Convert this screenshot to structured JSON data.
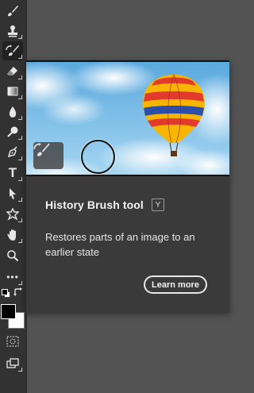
{
  "toolbar": {
    "tools": [
      {
        "name": "brush-icon",
        "glyph": "🖌"
      },
      {
        "name": "clone-stamp-icon",
        "glyph": "⚲"
      },
      {
        "name": "history-brush-icon",
        "glyph": "🖌"
      },
      {
        "name": "eraser-icon",
        "glyph": "⌫"
      },
      {
        "name": "gradient-icon",
        "glyph": "▭"
      },
      {
        "name": "blur-icon",
        "glyph": "💧"
      },
      {
        "name": "dodge-icon",
        "glyph": "🔍"
      },
      {
        "name": "pen-icon",
        "glyph": "✒"
      },
      {
        "name": "type-icon",
        "glyph": "T"
      },
      {
        "name": "path-selection-icon",
        "glyph": "➤"
      },
      {
        "name": "custom-shape-icon",
        "glyph": "✱"
      },
      {
        "name": "hand-icon",
        "glyph": "✋"
      },
      {
        "name": "zoom-icon",
        "glyph": "🔍"
      },
      {
        "name": "more-tools-icon",
        "glyph": "•••"
      }
    ],
    "foreground_color": "#000000",
    "background_color": "#ffffff",
    "quick-mask-icon": "quick-mask-icon",
    "screen-mode-icon": "screen-mode-icon"
  },
  "tooltip": {
    "title": "History Brush tool",
    "shortcut": "Y",
    "description": "Restores parts of an image to an earlier state",
    "learn_more": "Learn more"
  }
}
